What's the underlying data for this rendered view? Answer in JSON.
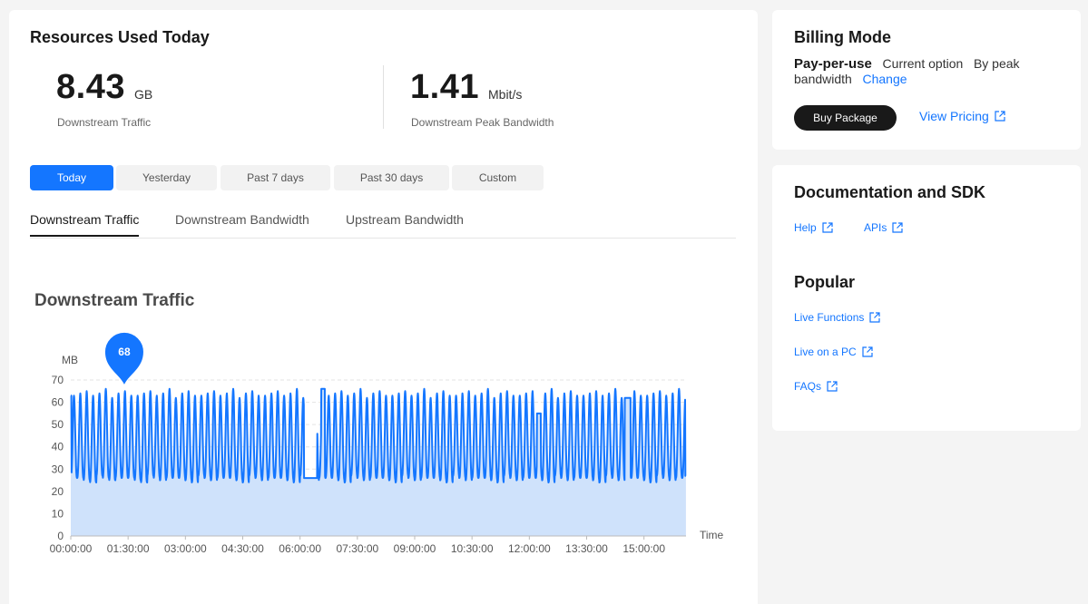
{
  "resources": {
    "title": "Resources Used Today",
    "traffic_value": "8.43",
    "traffic_unit": "GB",
    "traffic_label": "Downstream Traffic",
    "bandwidth_value": "1.41",
    "bandwidth_unit": "Mbit/s",
    "bandwidth_label": "Downstream Peak Bandwidth"
  },
  "ranges": [
    "Today",
    "Yesterday",
    "Past 7 days",
    "Past 30 days",
    "Custom"
  ],
  "active_range": "Today",
  "tabs": [
    "Downstream Traffic",
    "Downstream Bandwidth",
    "Upstream Bandwidth"
  ],
  "active_tab": "Downstream Traffic",
  "chart_data": {
    "type": "area",
    "title": "Downstream Traffic",
    "ylabel": "MB",
    "xlabel": "Time",
    "ylim": [
      0,
      70
    ],
    "yticks": [
      0,
      10,
      20,
      30,
      40,
      50,
      60,
      70
    ],
    "xticks": [
      "00:00:00",
      "01:30:00",
      "03:00:00",
      "04:30:00",
      "06:00:00",
      "07:30:00",
      "09:00:00",
      "10:30:00",
      "12:00:00",
      "13:30:00",
      "15:00:00"
    ],
    "x_range_hours": [
      0,
      16.1
    ],
    "peak_marker": {
      "label": "68",
      "x_hours": 1.4,
      "value": 68
    },
    "series": [
      {
        "period_minutes": 10,
        "trough_values": [
          26,
          26,
          25,
          24,
          27,
          26,
          25,
          26
        ],
        "peak_values": [
          63,
          64,
          65,
          63,
          64,
          66,
          62,
          64,
          65,
          63
        ],
        "flat_segments": [
          {
            "from_hours": 6.1,
            "to_hours": 6.45,
            "value": 26
          },
          {
            "from_hours": 6.55,
            "to_hours": 6.65,
            "value": 66
          },
          {
            "from_hours": 12.2,
            "to_hours": 12.3,
            "value": 55
          },
          {
            "from_hours": 14.5,
            "to_hours": 14.65,
            "value": 62
          }
        ]
      }
    ],
    "line_color": "#1476ff",
    "area_color": "#cfe2fb",
    "grid": true
  },
  "billing": {
    "title": "Billing Mode",
    "mode": "Pay-per-use",
    "current": "Current option",
    "by_peak": "By peak bandwidth",
    "change": "Change",
    "buy_label": "Buy Package",
    "view_pricing": "View Pricing"
  },
  "docs": {
    "title": "Documentation and SDK",
    "links": [
      "Help",
      "APIs"
    ],
    "popular_title": "Popular",
    "popular": [
      "Live Functions",
      "Live on a PC",
      "FAQs"
    ]
  },
  "colors": {
    "accent": "#1476ff",
    "dark_button": "#191919"
  }
}
